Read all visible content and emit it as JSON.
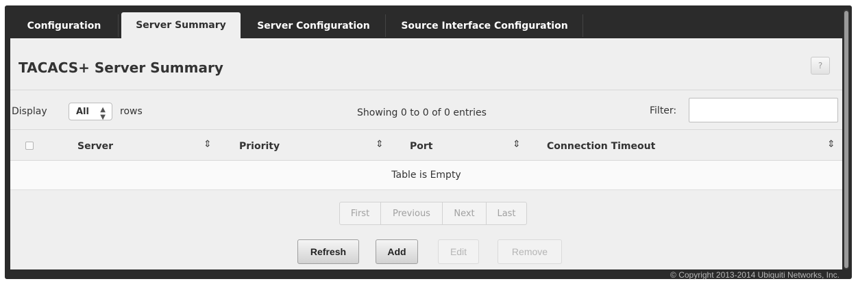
{
  "tabs": [
    {
      "label": "Configuration",
      "active": false
    },
    {
      "label": "Server Summary",
      "active": true
    },
    {
      "label": "Server Configuration",
      "active": false
    },
    {
      "label": "Source Interface Configuration",
      "active": false
    }
  ],
  "page": {
    "title": "TACACS+ Server Summary",
    "help_label": "?"
  },
  "toolbar": {
    "display_label": "Display",
    "rows_select_value": "All",
    "rows_label": "rows",
    "entries_info": "Showing 0 to 0 of 0 entries",
    "filter_label": "Filter:",
    "filter_value": ""
  },
  "table": {
    "columns": [
      "Server",
      "Priority",
      "Port",
      "Connection Timeout"
    ],
    "empty_message": "Table is Empty"
  },
  "pagination": [
    "First",
    "Previous",
    "Next",
    "Last"
  ],
  "buttons": {
    "refresh": "Refresh",
    "add": "Add",
    "edit": "Edit",
    "remove": "Remove"
  },
  "footer": {
    "copyright": "© Copyright 2013-2014 Ubiquiti Networks, Inc."
  },
  "icons": {
    "sort": "sort-updown-icon",
    "select_caret": "select-updown-icon",
    "help": "help-icon"
  },
  "colors": {
    "frame": "#2b2b2b",
    "panel": "#efefef",
    "active_tab": "#efefef"
  }
}
